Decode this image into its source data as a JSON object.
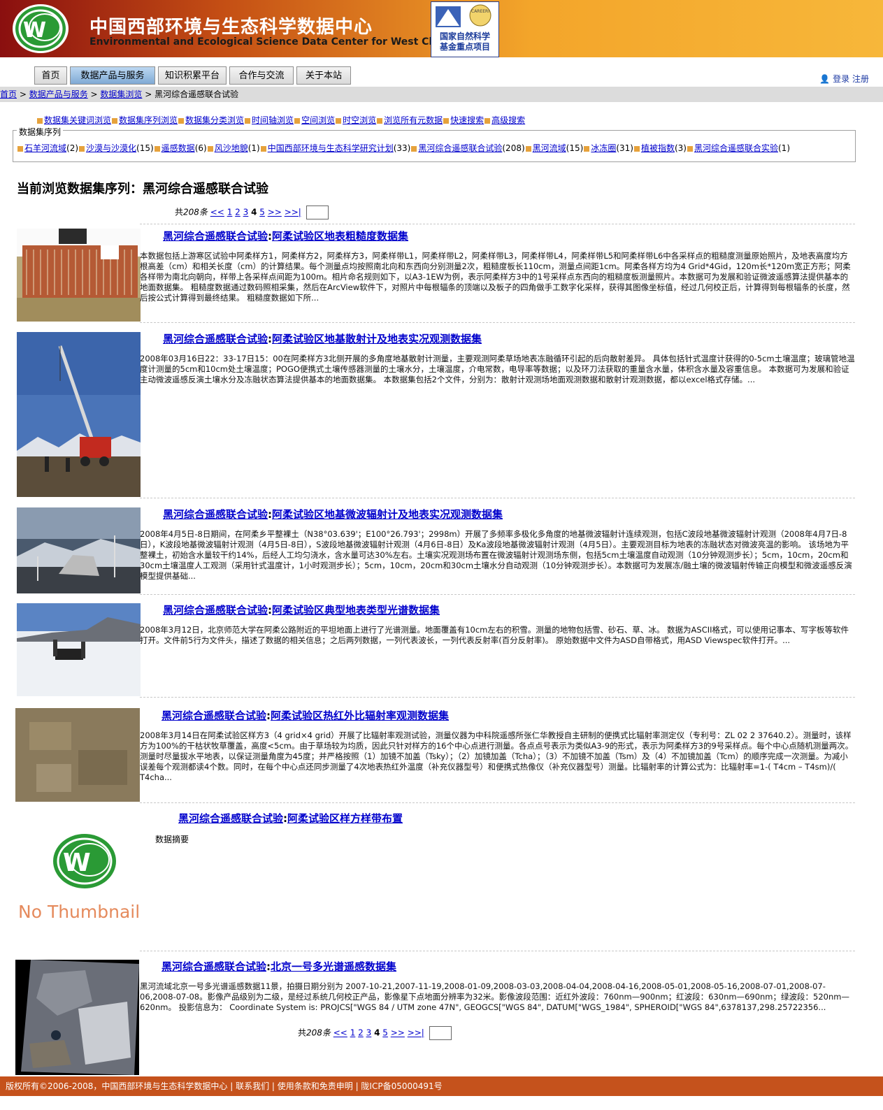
{
  "header": {
    "title_cn": "中国西部环境与生态科学数据中心",
    "title_en": "Environmental and Ecological Science Data Center for West China",
    "partner_label": "国家自然科学基金重点项目",
    "partner_badge": "CAREERI"
  },
  "nav": {
    "tabs": [
      "首页",
      "数据产品与服务",
      "知识积累平台",
      "合作与交流",
      "关于本站"
    ],
    "active_index": 1,
    "login": "登录",
    "register": "注册"
  },
  "breadcrumb": {
    "items": [
      "首页",
      "数据产品与服务",
      "数据集浏览"
    ],
    "current": "黑河综合遥感联合试验"
  },
  "quick_links": [
    "数据集关键词浏览",
    "数据集序列浏览",
    "数据集分类浏览",
    "时间轴浏览",
    "空间浏览",
    "时空浏览",
    "浏览所有元数据",
    "快速搜索",
    "高级搜索"
  ],
  "series_panel": {
    "legend": "数据集序列",
    "items": [
      {
        "name": "石羊河流域",
        "count": "(2)"
      },
      {
        "name": "沙漠与沙漠化",
        "count": "(15)"
      },
      {
        "name": "遥感数据",
        "count": "(6)"
      },
      {
        "name": "风沙地貌",
        "count": "(1)"
      },
      {
        "name": "中国西部环境与生态科学研究计划",
        "count": "(33)"
      },
      {
        "name": "黑河综合遥感联合试验",
        "count": "(208)"
      },
      {
        "name": "黑河流域",
        "count": "(15)"
      },
      {
        "name": "冰冻圈",
        "count": "(31)"
      },
      {
        "name": "植被指数",
        "count": "(3)"
      },
      {
        "name": "黑河综合遥感联合实验",
        "count": "(1)"
      }
    ]
  },
  "heading": "当前浏览数据集序列：黑河综合遥感联合试验",
  "pager": {
    "total_prefix": "共",
    "total": "208条",
    "first": "<<",
    "pages": [
      "1",
      "2",
      "3",
      "4",
      "5"
    ],
    "current": "4",
    "next": ">>",
    "last": ">>|"
  },
  "datasets": [
    {
      "series": "黑河综合遥感联合试验",
      "title": "阿柔试验区地表粗糙度数据集",
      "summary": "本数据包括上游寒区试验中阿柔样方1，阿柔样方2，阿柔样方3，阿柔样带L1，阿柔样带L2，阿柔样带L3，阿柔样带L4，阿柔样带L5和阿柔样带L6中各采样点的粗糙度测量原始照片，及地表高度均方根高差（cm）和相关长度（cm）的计算结果。每个测量点均按照南北向和东西向分别测量2次，粗糙度板长110cm，测量点间距1cm。阿柔各样方均为4 Grid*4Gid，120m长*120m宽正方形；阿柔各样带为南北向朝向，样带上各采样点间距为100m。相片命名规则如下，以A3-1EW为例，表示阿柔样方3中的1号采样点东西向的粗糙度板测量照片。本数据可为发展和验证微波遥感算法提供基本的地面数据集。 粗糙度数据通过数码照相采集，然后在ArcView软件下，对照片中每根辐条的顶端以及板子的四角做手工数字化采样，获得其图像坐标值，经过几何校正后，计算得到每根辐条的长度，然后按公式计算得到最终结果。 粗糙度数据如下所..."
    },
    {
      "series": "黑河综合遥感联合试验",
      "title": "阿柔试验区地基散射计及地表实况观测数据集",
      "summary": "2008年03月16日22：33-17日15：00在阿柔样方3北侧开展的多角度地基散射计测量，主要观测阿柔草场地表冻融循环引起的后向散射差异。 具体包括针式温度计获得的0-5cm土壤温度；玻璃管地温度计测量的5cm和10cm处土壤温度；POGO便携式土壤传感器测量的土壤水分，土壤温度，介电常数，电导率等数据；以及环刀法获取的重量含水量，体积含水量及容重信息。 本数据可为发展和验证主动微波遥感反演土壤水分及冻融状态算法提供基本的地面数据集。 本数据集包括2个文件，分别为：散射计观测场地面观测数据和散射计观测数据，都以excel格式存储。..."
    },
    {
      "series": "黑河综合遥感联合试验",
      "title": "阿柔试验区地基微波辐射计及地表实况观测数据集",
      "summary": "2008年4月5日-8日期间，在阿柔乡平整裸土（N38°03.639'；E100°26.793'；2998m）开展了多频率多极化多角度的地基微波辐射计连续观测，包括C波段地基微波辐射计观测（2008年4月7日-8日），K波段地基微波辐射计观测（4月5日-8日），S波段地基微波辐射计观测（4月6日-8日）及Ka波段地基微波辐射计观测（4月5日）。主要观测目标为地表的冻融状态对微波亮温的影响。 该场地为平整裸土，初始含水量较干约14%，后经人工均匀浇水，含水量可达30%左右。土壤实况观测场布置在微波辐射计观测场东侧，包括5cm土壤温度自动观测（10分钟观测步长）；5cm，10cm，20cm和30cm土壤温度人工观测（采用针式温度计，1小时观测步长）；5cm，10cm，20cm和30cm土壤水分自动观测（10分钟观测步长）。本数据可为发展冻/融土壤的微波辐射传输正向模型和微波遥感反演模型提供基础..."
    },
    {
      "series": "黑河综合遥感联合试验",
      "title": "阿柔试验区典型地表类型光谱数据集",
      "summary": "2008年3月12日，北京师范大学在阿柔公路附近的平坦地面上进行了光谱测量。地面覆盖有10cm左右的积雪。测量的地物包括雪、砂石、草、冰。 数据为ASCII格式，可以使用记事本、写字板等软件打开。文件前5行为文件头，描述了数据的相关信息；之后两列数据，一列代表波长，一列代表反射率(百分反射率)。 原始数据中文件为ASD自带格式，用ASD Viewspec软件打开。..."
    },
    {
      "series": "黑河综合遥感联合试验",
      "title": "阿柔试验区热红外比辐射率观测数据集",
      "summary": "2008年3月14日在阿柔试验区样方3（4 grid×4 grid）开展了比辐射率观测试验，测量仪器为中科院遥感所张仁华教授自主研制的便携式比辐射率测定仪（专利号：ZL 02 2 37640.2）。测量时，该样方为100%的干枯状牧草覆盖，高度<5cm。由于草场较为均质，因此只针对样方的16个中心点进行测量。各点点号表示为类似A3-9的形式，表示为阿柔样方3的9号采样点。每个中心点随机测量两次。 测量时尽量拔水平地表，以保证测量角度为45度；并严格按照（1）加镜不加盖（Tsky）；（2）加镜加盖（Tcha）；（3）不加镜不加盖（Tsm）及（4）不加镜加盖（Tcm）的顺序完成一次测量。为减小误差每个观测都读4个数。同时，在每个中心点还同步测量了4次地表热红外温度（补充仪器型号）和便携式热像仪（补充仪器型号）测量。比辐射率的计算公式为：比辐射率=1-( T4cm – T4sm)/( T4cha..."
    },
    {
      "series": "黑河综合遥感联合试验",
      "title": "阿柔试验区样方样带布置",
      "summary": "数据摘要",
      "no_thumbnail_label": "No Thumbnail"
    },
    {
      "series": "黑河综合遥感联合试验",
      "title": "北京一号多光谱遥感数据集",
      "summary": "黑河流域北京一号多光谱遥感数据11景，拍摄日期分别为 2007-10-21,2007-11-19,2008-01-09,2008-03-03,2008-04-04,2008-04-16,2008-05-01,2008-05-16,2008-07-01,2008-07-06,2008-07-08。影像产品级别为二级，是经过系统几何校正产品，影像星下点地面分辨率为32米。影像波段范围：近红外波段：760nm—900nm；红波段：630nm—690nm；绿波段：520nm—620nm。 投影信息为： Coordinate System is: PROJCS[\"WGS 84 / UTM zone 47N\", GEOGCS[\"WGS 84\", DATUM[\"WGS_1984\", SPHEROID[\"WGS 84\",6378137,298.25722356..."
    }
  ],
  "footer": {
    "text": "版权所有©2006-2008，中国西部环境与生态科学数据中心 | 联系我们 | 使用条款和免责申明 | 陇ICP备05000491号"
  },
  "colors": {
    "banner_dark": "#8a0f0f",
    "banner_light": "#f7b73a",
    "footer": "#c5521c",
    "link": "#0000cc",
    "title_link": "#0000ee",
    "active_tab": "#7fa9d4"
  }
}
